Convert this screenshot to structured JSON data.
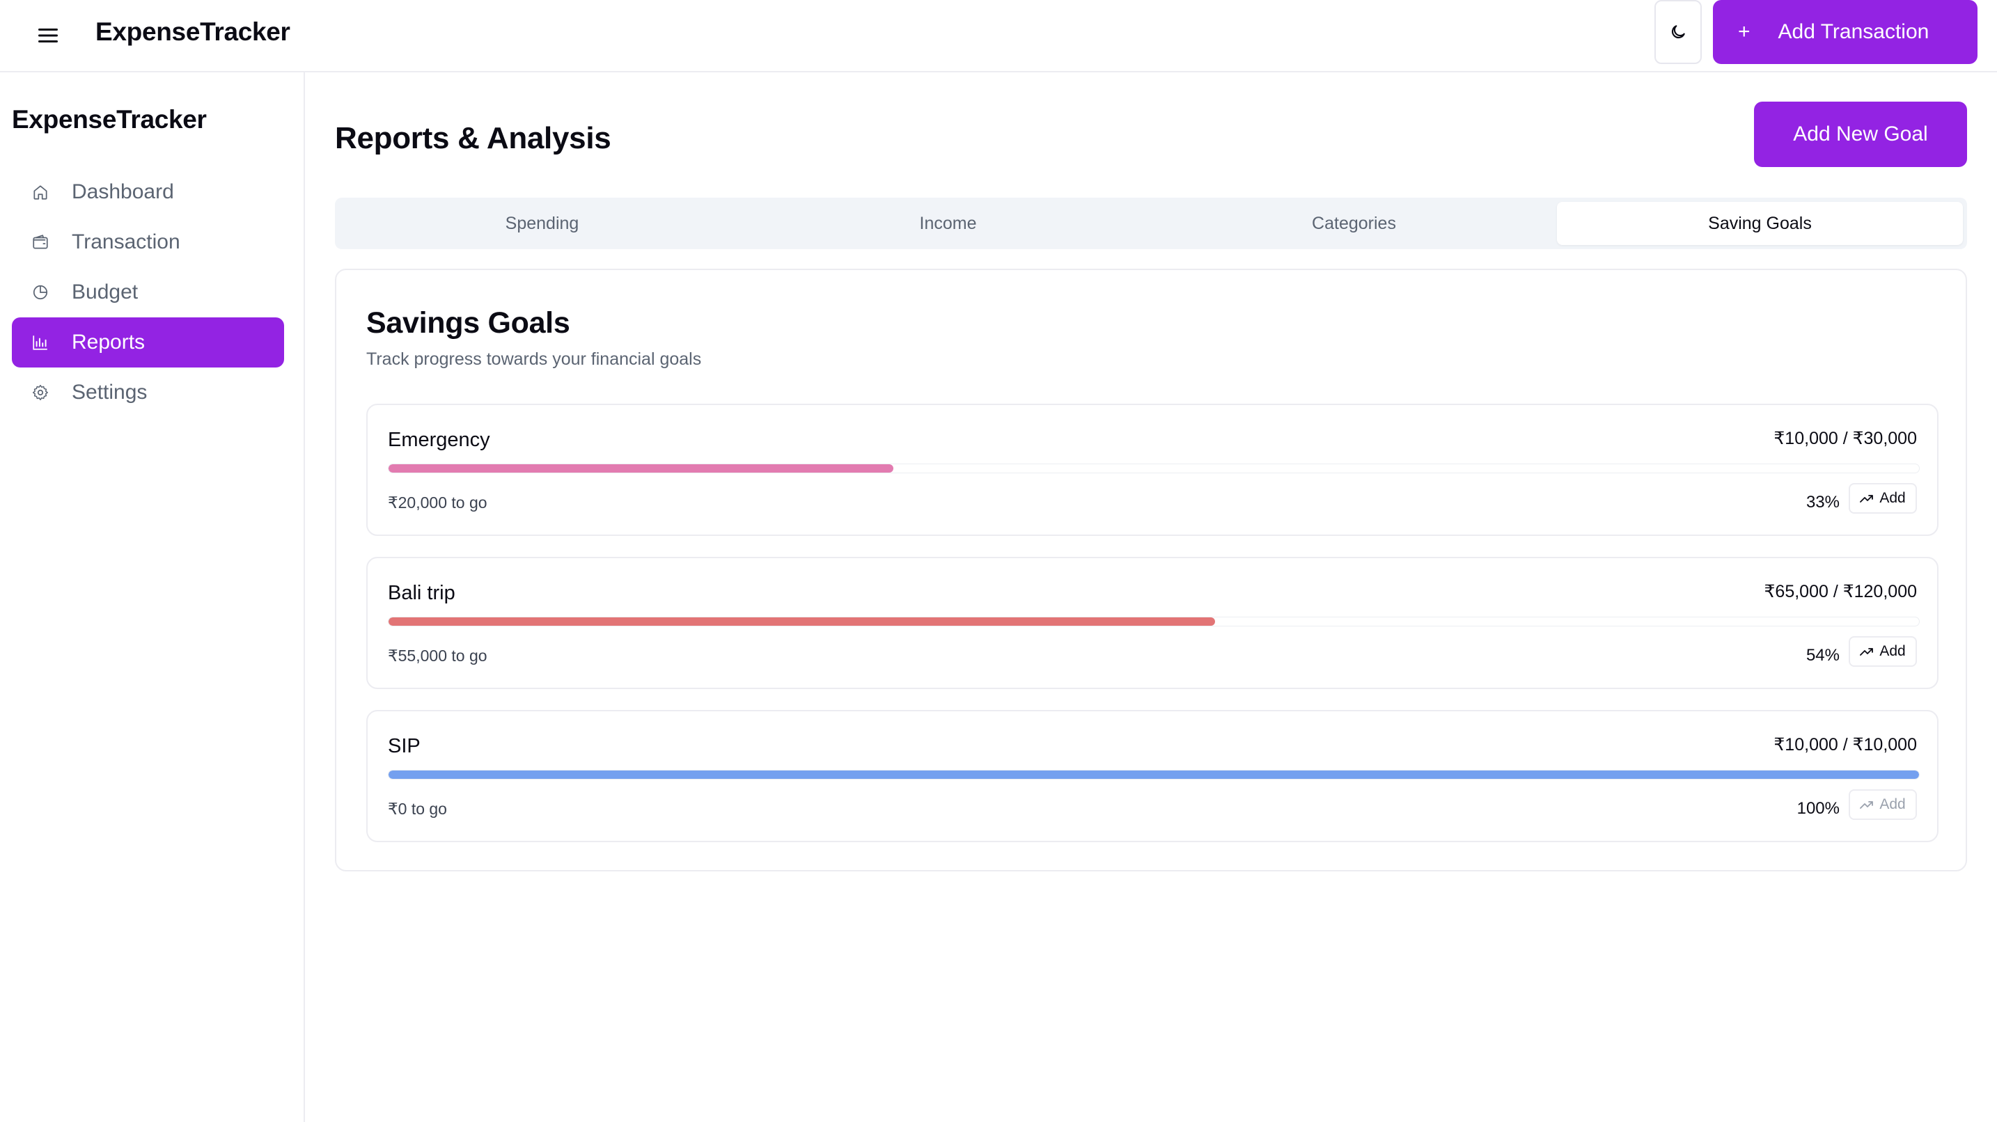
{
  "app": {
    "brand": "ExpenseTracker",
    "add_transaction_label": "Add Transaction",
    "add_transaction_icon": "plus-icon",
    "theme_icon": "moon-icon",
    "menu_icon": "hamburger-icon"
  },
  "sidebar": {
    "brand": "ExpenseTracker",
    "items": [
      {
        "label": "Dashboard",
        "icon": "home-icon",
        "active": false
      },
      {
        "label": "Transaction",
        "icon": "wallet-icon",
        "active": false
      },
      {
        "label": "Budget",
        "icon": "pie-chart-icon",
        "active": false
      },
      {
        "label": "Reports",
        "icon": "bar-chart-icon",
        "active": true
      },
      {
        "label": "Settings",
        "icon": "gear-icon",
        "active": false
      }
    ]
  },
  "main": {
    "title": "Reports & Analysis",
    "add_goal_label": "Add New Goal",
    "tabs": [
      {
        "label": "Spending",
        "active": false
      },
      {
        "label": "Income",
        "active": false
      },
      {
        "label": "Categories",
        "active": false
      },
      {
        "label": "Saving Goals",
        "active": true
      }
    ],
    "card": {
      "title": "Savings Goals",
      "subtitle": "Track progress towards your financial goals",
      "goals": [
        {
          "name": "Emergency",
          "amount": "₹10,000 / ₹30,000",
          "to_go": "₹20,000 to go",
          "percent_label": "33%",
          "progress": 0.33,
          "color": "#e27bb0",
          "add_label": "Add",
          "add_enabled": true
        },
        {
          "name": "Bali trip",
          "amount": "₹65,000 / ₹120,000",
          "to_go": "₹55,000 to go",
          "percent_label": "54%",
          "progress": 0.54,
          "color": "#e27475",
          "add_label": "Add",
          "add_enabled": true
        },
        {
          "name": "SIP",
          "amount": "₹10,000 / ₹10,000",
          "to_go": "₹0 to go",
          "percent_label": "100%",
          "progress": 1.0,
          "color": "#74a0ef",
          "add_label": "Add",
          "add_enabled": false
        }
      ]
    }
  },
  "colors": {
    "accent": "#9323e3",
    "muted_text": "#5b6472",
    "border": "#ececf1",
    "tabs_bg": "#f1f4f8"
  }
}
